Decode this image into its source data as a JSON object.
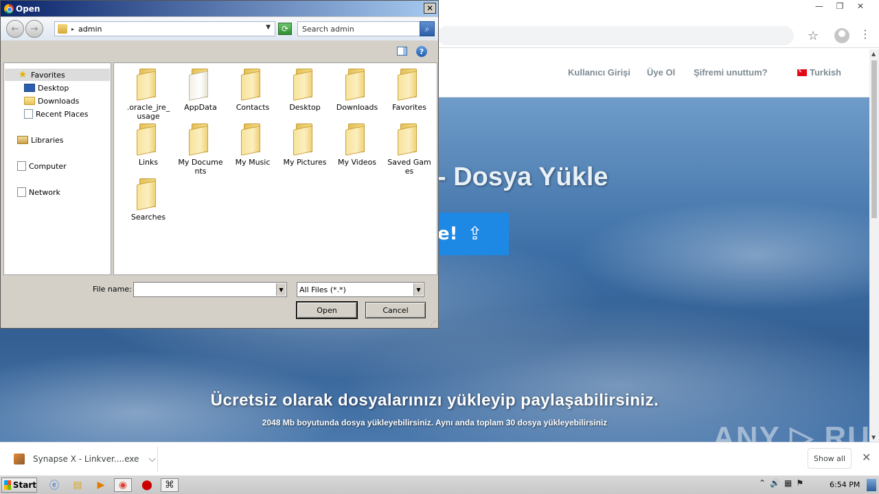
{
  "browser": {
    "window_controls": [
      "—",
      "❐",
      "✕"
    ],
    "menu_icon": "⋮"
  },
  "site": {
    "nav": {
      "login": "Kullanıcı Girişi",
      "register": "Üye Ol",
      "forgot": "Şifremi unuttum?",
      "language": "Turkish"
    },
    "hero_title": "- Dosya Yükle",
    "upload_button_text": "e!",
    "headline": "Ücretsiz olarak dosyalarınızı yükleyip paylaşabilirsiniz.",
    "subline": "2048 Mb boyutunda dosya yükleyebilirsiniz. Aynı anda toplam 30 dosya yükleyebilirsiniz"
  },
  "watermark": "ANY ▷ RUN",
  "downloads": {
    "file_name": "Synapse X - Linkver....exe",
    "show_all": "Show all"
  },
  "taskbar": {
    "start": "Start",
    "clock": "6:54 PM"
  },
  "dialog": {
    "title": "Open",
    "location": "admin",
    "search_placeholder": "Search admin",
    "nav_pane": {
      "favorites": "Favorites",
      "desktop": "Desktop",
      "downloads": "Downloads",
      "recent": "Recent Places",
      "libraries": "Libraries",
      "computer": "Computer",
      "network": "Network"
    },
    "files": [
      {
        "label": ".oracle_jre_usage"
      },
      {
        "label": "AppData"
      },
      {
        "label": "Contacts"
      },
      {
        "label": "Desktop"
      },
      {
        "label": "Downloads"
      },
      {
        "label": "Favorites"
      },
      {
        "label": "Links"
      },
      {
        "label": "My Documents"
      },
      {
        "label": "My Music"
      },
      {
        "label": "My Pictures"
      },
      {
        "label": "My Videos"
      },
      {
        "label": "Saved Games"
      },
      {
        "label": "Searches"
      }
    ],
    "file_name_label": "File name:",
    "file_name_value": "",
    "file_type": "All Files (*.*)",
    "open_button": "Open",
    "cancel_button": "Cancel"
  }
}
